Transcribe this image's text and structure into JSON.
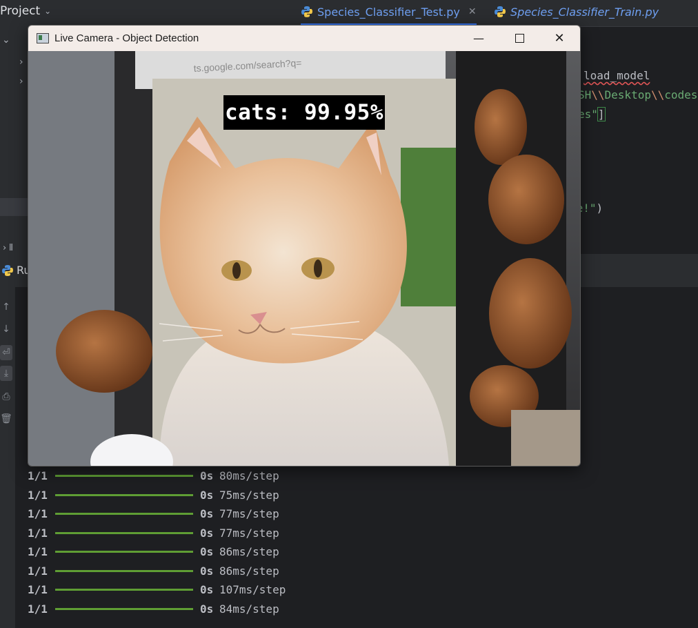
{
  "ide": {
    "project_label": "Project",
    "tabs": [
      {
        "label": "Species_Classifier_Test.py",
        "active": true
      },
      {
        "label": "Species_Classifier_Train.py",
        "active": false
      }
    ],
    "code_fragments": {
      "line1": "load_model",
      "line2_prefix": "SH",
      "line2_esc1": "\\\\",
      "line2_mid": "Desktop",
      "line2_esc2": "\\\\",
      "line2_end": "codes",
      "line3_str": "es\"",
      "line3_bracket": "]",
      "line4_str": "ge!\"",
      "line4_paren": ")"
    },
    "run_label": "Ru",
    "colors": {
      "accent": "#3574f0",
      "progress": "#5f9e34",
      "string": "#6aab73",
      "escape": "#cf8e6d"
    }
  },
  "camera_window": {
    "title": "Live Camera - Object Detection",
    "detection_label": "cats: 99.95%",
    "icons": {
      "minimize": "minimize-icon",
      "maximize": "maximize-icon",
      "close": "close-icon"
    }
  },
  "console": {
    "steps": [
      {
        "frac": "1/1",
        "sec": "0s",
        "time": "80ms/step"
      },
      {
        "frac": "1/1",
        "sec": "0s",
        "time": "75ms/step"
      },
      {
        "frac": "1/1",
        "sec": "0s",
        "time": "77ms/step"
      },
      {
        "frac": "1/1",
        "sec": "0s",
        "time": "77ms/step"
      },
      {
        "frac": "1/1",
        "sec": "0s",
        "time": "86ms/step"
      },
      {
        "frac": "1/1",
        "sec": "0s",
        "time": "86ms/step"
      },
      {
        "frac": "1/1",
        "sec": "0s",
        "time": "107ms/step"
      },
      {
        "frac": "1/1",
        "sec": "0s",
        "time": "84ms/step"
      }
    ]
  }
}
